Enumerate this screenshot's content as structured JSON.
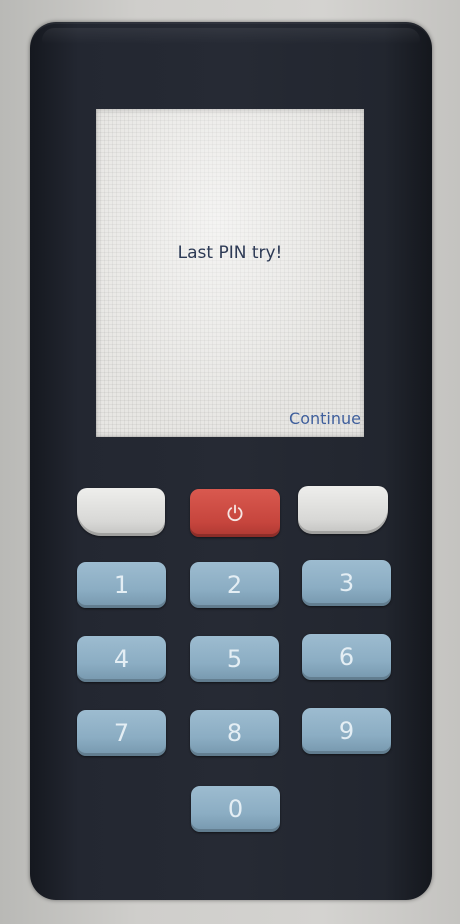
{
  "screen": {
    "message": "Last PIN try!",
    "action_label": "Continue"
  },
  "keypad": {
    "power_icon": "power-icon",
    "keys": [
      "1",
      "2",
      "3",
      "4",
      "5",
      "6",
      "7",
      "8",
      "9",
      "0"
    ]
  },
  "colors": {
    "device_body": "#262a34",
    "screen_background": "#e7e6e3",
    "message_text": "#2d3a55",
    "action_text": "#3f5f9c",
    "power_key": "#c6453d",
    "soft_key": "#d8d8d6",
    "number_key": "#8badc3"
  }
}
